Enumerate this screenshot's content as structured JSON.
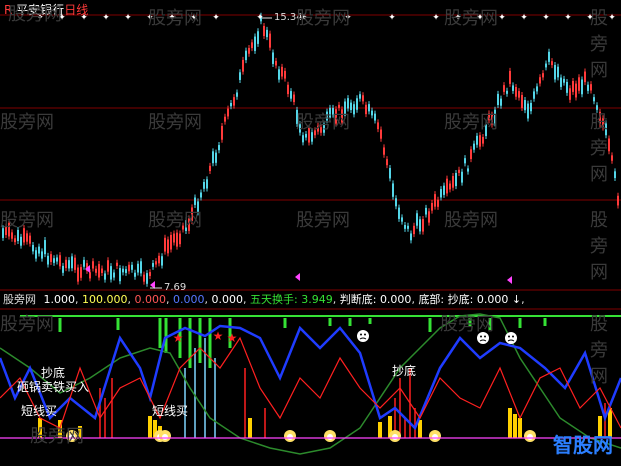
{
  "header": {
    "marker": "R",
    "stock": "平安银行",
    "period": "日线"
  },
  "price": {
    "high_label": "15.34",
    "low_label": "7.69"
  },
  "indicator_bar": {
    "name": "股旁网",
    "v1": "1.000",
    "v2": "100.000",
    "v3": "0.000",
    "v4": "0.000",
    "v5": "0.000",
    "five_day_label": "五天换手:",
    "five_day_value": "3.949",
    "judge_bottom_label": "判断底:",
    "judge_bottom_value": "0.000",
    "bottom_part_label": "底部:",
    "copy_bottom_label": "抄底:",
    "copy_bottom_value": "0.000"
  },
  "signals": {
    "chaodi_1": "抄底",
    "guoguo_buy": "砸锅卖铁买入",
    "short_buy_1": "短线买",
    "short_buy_2": "短线买",
    "chaodi_2": "抄底"
  },
  "watermark": "股旁网",
  "logo": "智股网",
  "colors": {
    "price_up": "#ff3a3a",
    "price_down": "#54d6e8",
    "grid": "#800000",
    "blue_line": "#1f3cff",
    "green_line": "#2c8a2c",
    "red_line": "#ff2020",
    "bright_green": "#35e235",
    "yellow": "#ffd000",
    "magenta": "#ff44ff"
  }
}
